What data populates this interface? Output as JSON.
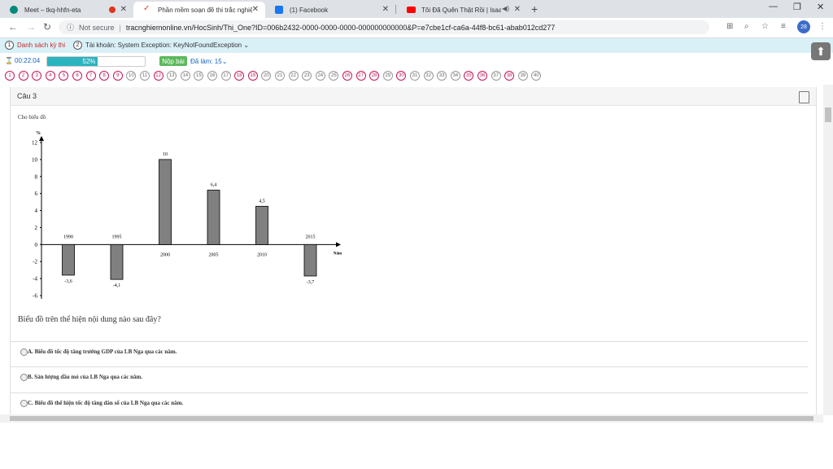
{
  "browser": {
    "tabs": [
      {
        "title": "Meet – tkq-hhfn-eta",
        "icon_color": "#00897b"
      },
      {
        "title": "Phần mềm soạn đề thi trắc nghiệ",
        "icon_color": "#e53935"
      },
      {
        "title": "(1) Facebook",
        "icon_color": "#1877f2"
      },
      {
        "title": "Tôi Đã Quên Thật Rồi | Isaac",
        "icon_color": "#ff0000"
      }
    ],
    "new_tab": "+",
    "not_secure": "Not secure",
    "url": "tracnghiemonline.vn/HocSinh/Thi_One?ID=006b2432-0000-0000-0000-000000000000&P=e7cbe1cf-ca6a-44f8-bc61-abab012cd277",
    "profile_badge": "28"
  },
  "exam_bar": {
    "item1_num": "1",
    "item1_label": "Danh sách kỳ thi",
    "item2_num": "2",
    "item2_label": "Tài khoản: System Exception: KeyNotFoundException",
    "timer": "00:22:04",
    "progress_text": "52%",
    "progress_value": 0.52,
    "submit_label": "Nộp bài",
    "done_label": "Đã làm: 15"
  },
  "question_numbers": [
    {
      "n": "1",
      "red": true
    },
    {
      "n": "2",
      "red": true
    },
    {
      "n": "3",
      "red": true
    },
    {
      "n": "4",
      "red": true
    },
    {
      "n": "5",
      "red": true
    },
    {
      "n": "6",
      "red": true
    },
    {
      "n": "7",
      "red": true
    },
    {
      "n": "8",
      "red": true
    },
    {
      "n": "9",
      "red": true
    },
    {
      "n": "10",
      "red": false
    },
    {
      "n": "11",
      "red": false
    },
    {
      "n": "12",
      "red": true
    },
    {
      "n": "13",
      "red": false
    },
    {
      "n": "14",
      "red": false
    },
    {
      "n": "15",
      "red": false
    },
    {
      "n": "16",
      "red": false
    },
    {
      "n": "17",
      "red": false
    },
    {
      "n": "18",
      "red": true
    },
    {
      "n": "19",
      "red": true
    },
    {
      "n": "20",
      "red": false
    },
    {
      "n": "21",
      "red": false
    },
    {
      "n": "22",
      "red": false
    },
    {
      "n": "23",
      "red": false
    },
    {
      "n": "24",
      "red": false
    },
    {
      "n": "25",
      "red": false
    },
    {
      "n": "26",
      "red": true
    },
    {
      "n": "27",
      "red": true
    },
    {
      "n": "28",
      "red": true
    },
    {
      "n": "29",
      "red": false
    },
    {
      "n": "30",
      "red": true
    },
    {
      "n": "31",
      "red": false
    },
    {
      "n": "32",
      "red": false
    },
    {
      "n": "33",
      "red": false
    },
    {
      "n": "34",
      "red": false
    },
    {
      "n": "35",
      "red": true
    },
    {
      "n": "36",
      "red": true
    },
    {
      "n": "37",
      "red": false
    },
    {
      "n": "38",
      "red": true
    },
    {
      "n": "39",
      "red": false
    },
    {
      "n": "40",
      "red": false
    }
  ],
  "question": {
    "title": "Câu 3",
    "prompt": "Cho biểu đồ",
    "text": "Biểu đồ trên thể hiện nội dung nào sau đây?",
    "options": [
      {
        "label": "A.",
        "text": "Biểu đồ tốc độ tăng trưởng GDP của LB Nga qua các năm."
      },
      {
        "label": "B.",
        "text": "Sản lượng dầu mỏ của LB Nga qua các năm."
      },
      {
        "label": "C.",
        "text": "Biểu đồ thể hiện tốc độ tăng dân số của LB Nga qua các năm."
      }
    ]
  },
  "chart_data": {
    "type": "bar",
    "categories": [
      "1990",
      "1995",
      "2000",
      "2005",
      "2010",
      "2015"
    ],
    "values": [
      -3.6,
      -4.1,
      10,
      6.4,
      4.5,
      -3.7
    ],
    "value_labels": [
      "-3,6",
      "-4,1",
      "10",
      "6,4",
      "4,5",
      "-3,7"
    ],
    "ylabel": "%",
    "xlabel": "Năm",
    "ylim": [
      -6,
      12
    ],
    "yticks": [
      "-6",
      "-4",
      "-2",
      "0",
      "2",
      "4",
      "6",
      "8",
      "10",
      "12"
    ],
    "bar_color": "#808080"
  }
}
